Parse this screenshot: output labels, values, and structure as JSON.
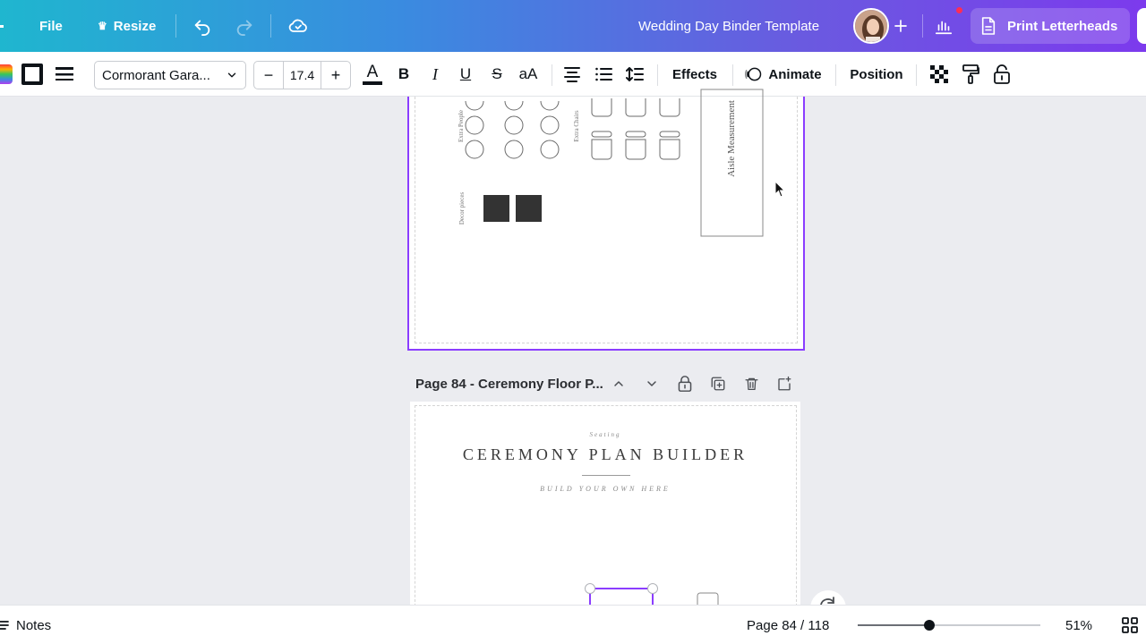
{
  "header": {
    "file_label": "File",
    "resize_label": "Resize",
    "doc_title": "Wedding Day Binder Template",
    "print_label": "Print Letterheads"
  },
  "toolbar": {
    "font_name": "Cormorant Gara...",
    "font_size": "17.4",
    "minus": "−",
    "plus": "+",
    "color_letter": "A",
    "bold": "B",
    "italic": "I",
    "underline": "U",
    "strike": "S",
    "case": "aA",
    "effects_label": "Effects",
    "animate_label": "Animate",
    "position_label": "Position",
    "accent_underline_color": "#e3342f"
  },
  "canvas": {
    "upper_page": {
      "extra_people": "Extra People",
      "extra_chairs": "Extra Chairs",
      "decor_pieces": "Decor pieces",
      "aisle_measurement": "Aisle Measurement"
    },
    "page_label": "Page 84 - Ceremony Floor P...",
    "lower_page": {
      "eyebrow": "Seating",
      "title": "CEREMONY PLAN BUILDER",
      "subtitle": "BUILD YOUR OWN HERE"
    }
  },
  "footer": {
    "notes_label": "Notes",
    "page_counter": "Page 84 / 118",
    "zoom_value": "51%",
    "zoom_level": 0.39
  },
  "colors": {
    "selection": "#8b3dff",
    "header_gradient_start": "#1fb6cf",
    "header_gradient_end": "#7c3aed"
  }
}
